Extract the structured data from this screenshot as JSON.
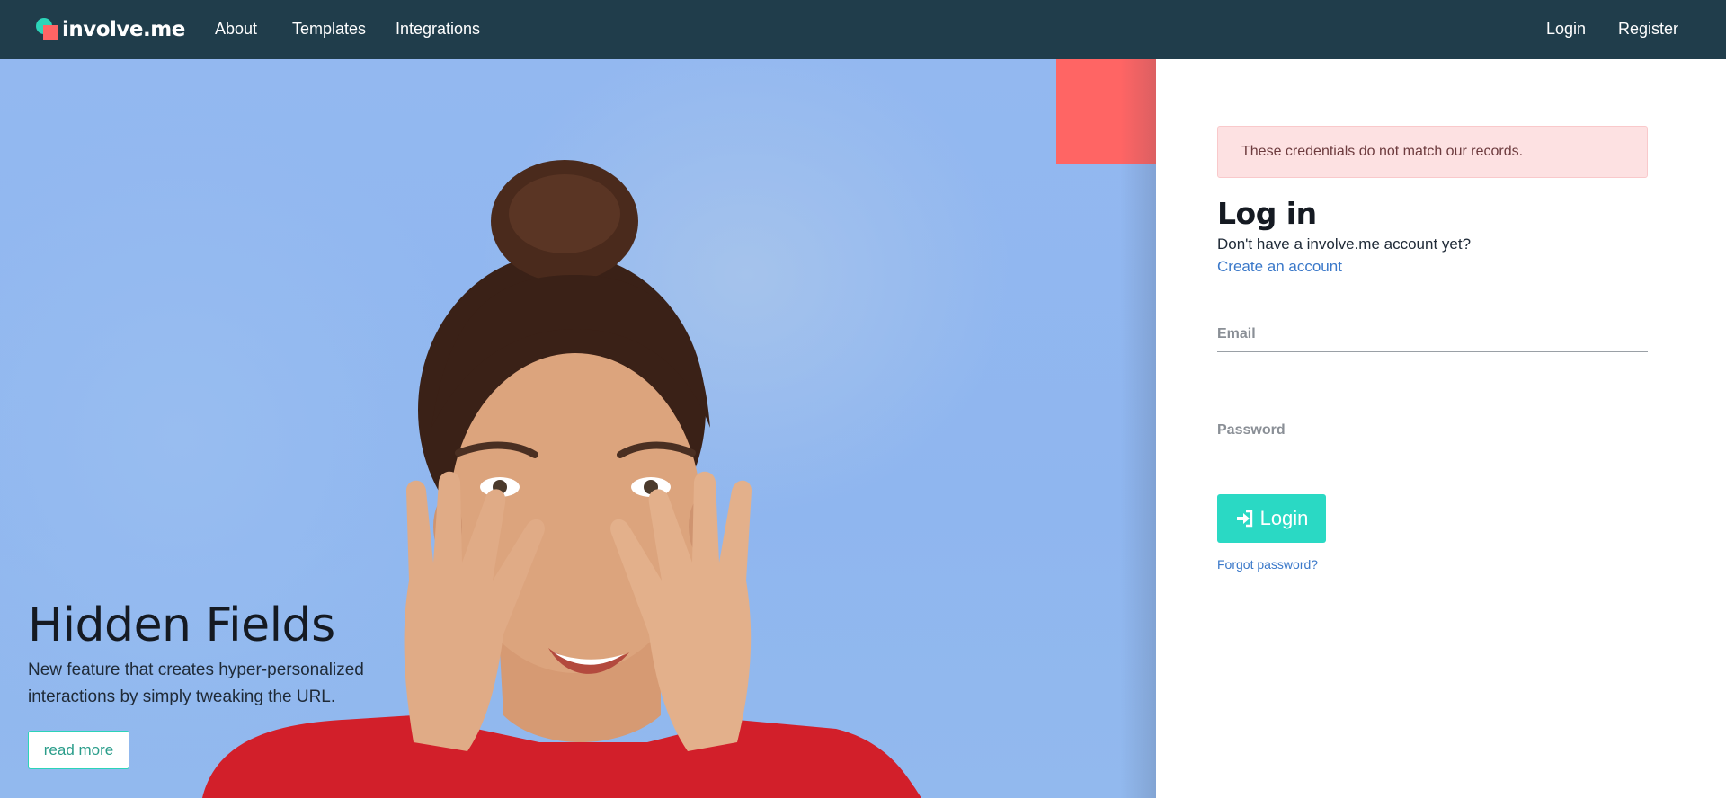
{
  "brand": {
    "name": "involve.me"
  },
  "nav": {
    "left": [
      {
        "label": "About"
      },
      {
        "label": "Templates"
      },
      {
        "label": "Integrations"
      }
    ],
    "right": [
      {
        "label": "Login"
      },
      {
        "label": "Register"
      }
    ]
  },
  "hero": {
    "title": "Hidden Fields",
    "description": "New feature that creates hyper-personalized interactions by simply tweaking the URL.",
    "button_label": "read more"
  },
  "login": {
    "alert": "These credentials do not match our records.",
    "title": "Log in",
    "no_account_text": "Don't have a involve.me account yet?",
    "create_account_link": "Create an account",
    "email_placeholder": "Email",
    "password_placeholder": "Password",
    "submit_label": "Login",
    "forgot_link": "Forgot password?"
  },
  "colors": {
    "navbar": "#203d4b",
    "accent_teal": "#2ad9c4",
    "accent_coral": "#ff6564",
    "link_blue": "#3a78c9",
    "alert_bg": "#fde1e2"
  }
}
